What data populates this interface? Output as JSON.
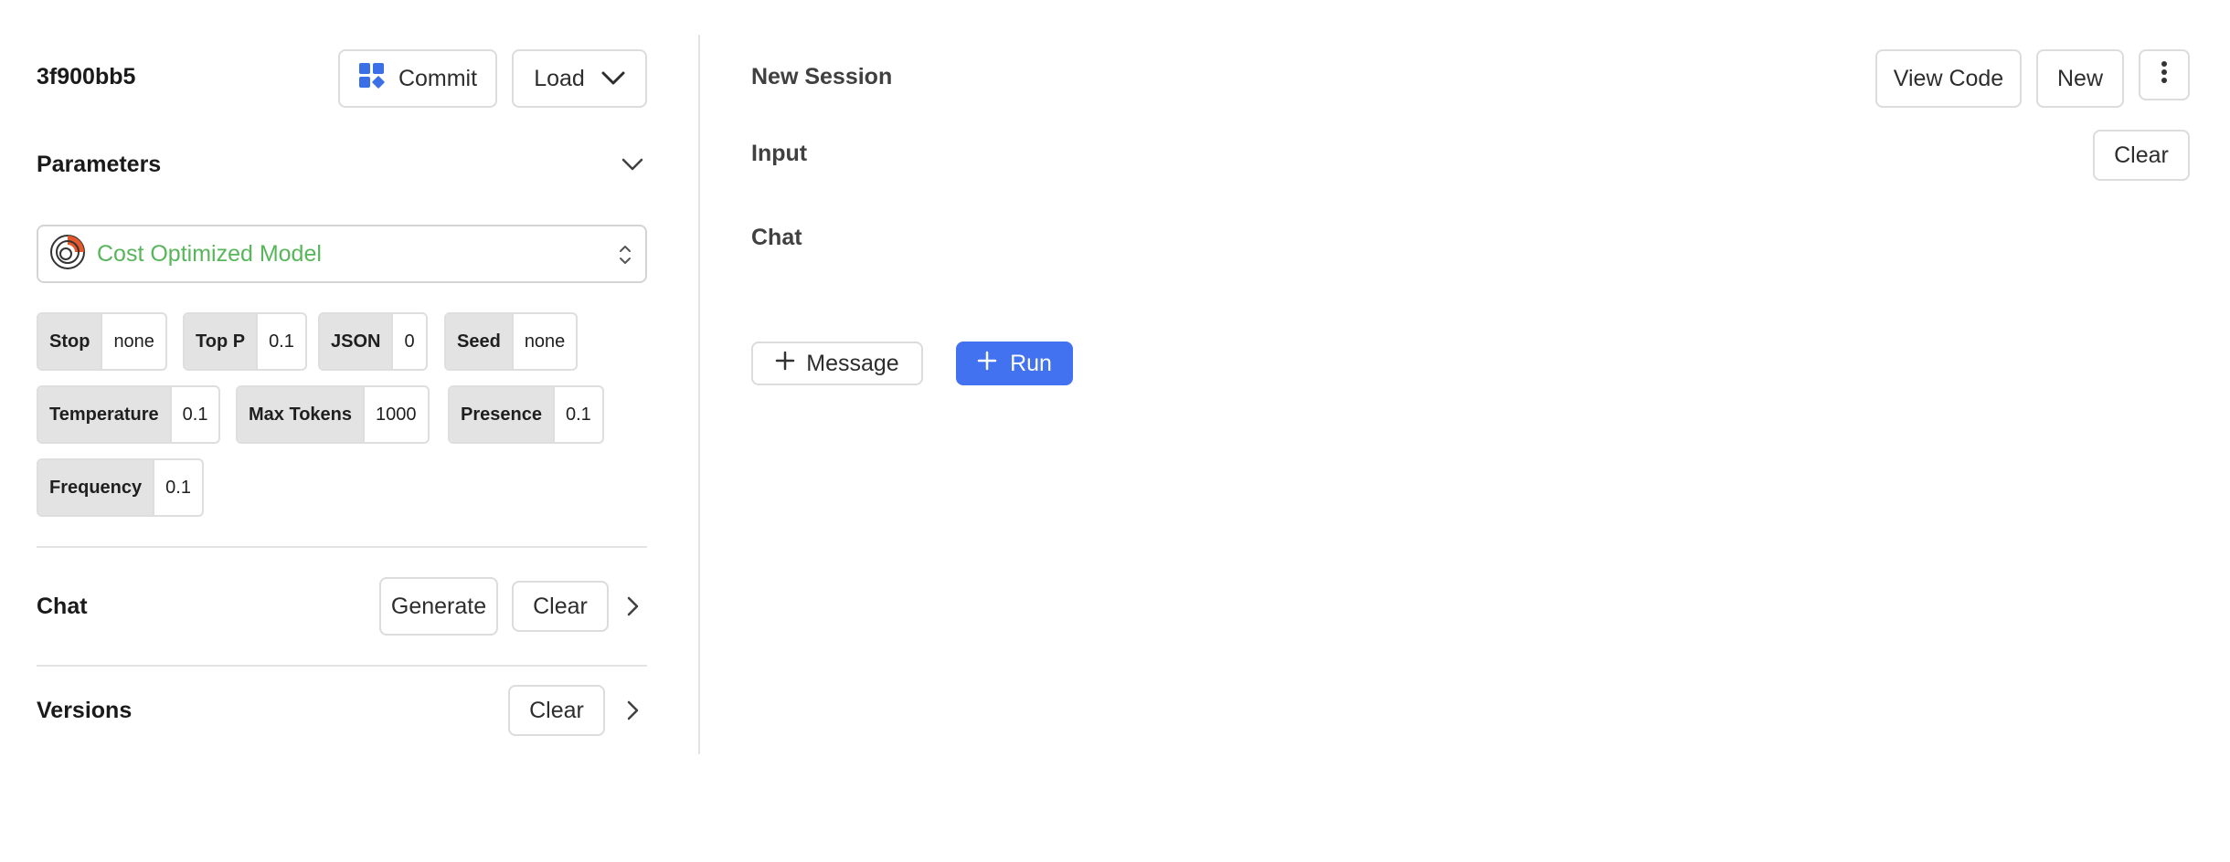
{
  "left": {
    "commit_hash": "3f900bb5",
    "commit_label": "Commit",
    "load_label": "Load",
    "parameters_title": "Parameters",
    "model": {
      "label": "Cost Optimized Model",
      "label_color": "#57b65a"
    },
    "params": [
      {
        "key": "Stop",
        "value": "none"
      },
      {
        "key": "Top P",
        "value": "0.1"
      },
      {
        "key": "JSON",
        "value": "0"
      },
      {
        "key": "Seed",
        "value": "none"
      },
      {
        "key": "Temperature",
        "value": "0.1"
      },
      {
        "key": "Max Tokens",
        "value": "1000"
      },
      {
        "key": "Presence",
        "value": "0.1"
      },
      {
        "key": "Frequency",
        "value": "0.1"
      }
    ],
    "chat": {
      "title": "Chat",
      "generate_label": "Generate",
      "clear_label": "Clear"
    },
    "versions": {
      "title": "Versions",
      "clear_label": "Clear"
    }
  },
  "right": {
    "session_title": "New Session",
    "view_code_label": "View Code",
    "new_label": "New",
    "input_label": "Input",
    "input_clear_label": "Clear",
    "chat_label": "Chat",
    "message_label": "Message",
    "run_label": "Run",
    "run_color": "#4372f0"
  },
  "icons": {
    "commit": "grid-shapes-icon",
    "load": "chevron-down-icon",
    "params_toggle": "chevron-down-icon",
    "model": "model-logo-icon",
    "model_select": "up-down-chevron-icon",
    "chat_expand": "chevron-right-icon",
    "versions_expand": "chevron-right-icon",
    "more": "more-vertical-icon",
    "message": "plus-icon",
    "run": "plus-icon"
  }
}
